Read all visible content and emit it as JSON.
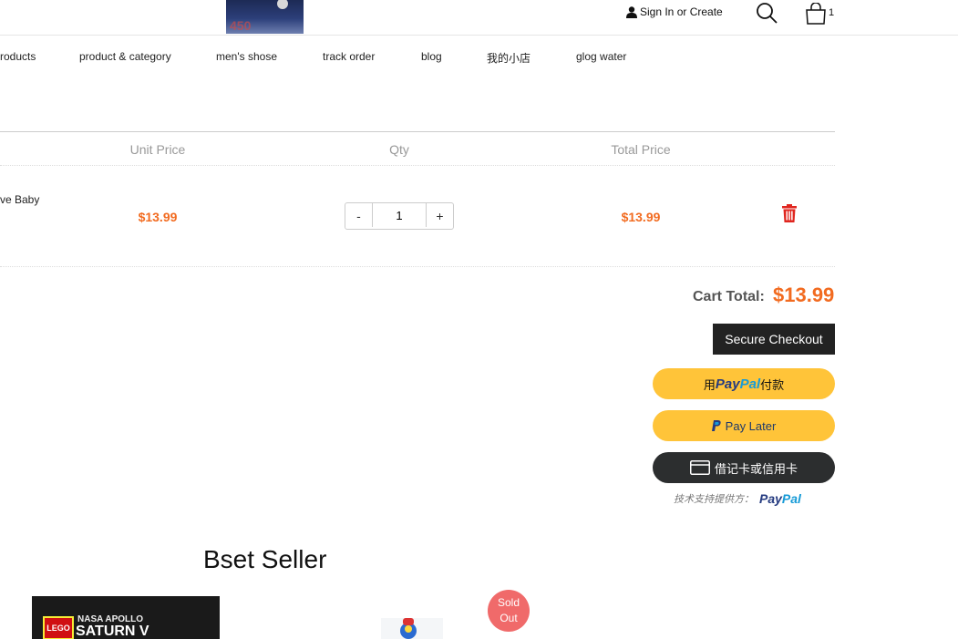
{
  "header": {
    "signin_label": "Sign In or Create",
    "cart_count": "1"
  },
  "nav": {
    "items": [
      "roducts",
      "product & category",
      "men's shose",
      "track order",
      "blog",
      "我的小店",
      "glog water"
    ]
  },
  "cart": {
    "headers": {
      "unit_price": "Unit Price",
      "qty": "Qty",
      "total_price": "Total Price"
    },
    "item": {
      "name": "ve Baby",
      "unit_price": "$13.99",
      "qty_minus": "-",
      "qty_value": "1",
      "qty_plus": "+",
      "total_price": "$13.99"
    },
    "total_label": "Cart Total:",
    "total_value": "$13.99",
    "checkout_label": "Secure Checkout"
  },
  "paypal": {
    "btn1_prefix": "用",
    "btn1_suffix": "付款",
    "logo_pay": "Pay",
    "logo_pal": "Pal",
    "later_label": "Pay Later",
    "card_label": "借记卡或信用卡",
    "powered_by": "技术支持提供方："
  },
  "best_seller": {
    "title": "Bset Seller",
    "product1_brand": "LEGO",
    "product1_line1": "NASA APOLLO",
    "product1_line2": "SATURN V",
    "soldout_line1": "Sold",
    "soldout_line2": "Out"
  },
  "colors": {
    "accent_price": "#f26b20",
    "paypal_yellow": "#ffc439",
    "checkout_bg": "#222222",
    "trash_red": "#e0261f",
    "soldout_bg": "#f06a6a"
  },
  "icons": [
    "user-icon",
    "search-icon",
    "cart-icon",
    "trash-icon",
    "paypal-p-icon",
    "card-icon"
  ]
}
